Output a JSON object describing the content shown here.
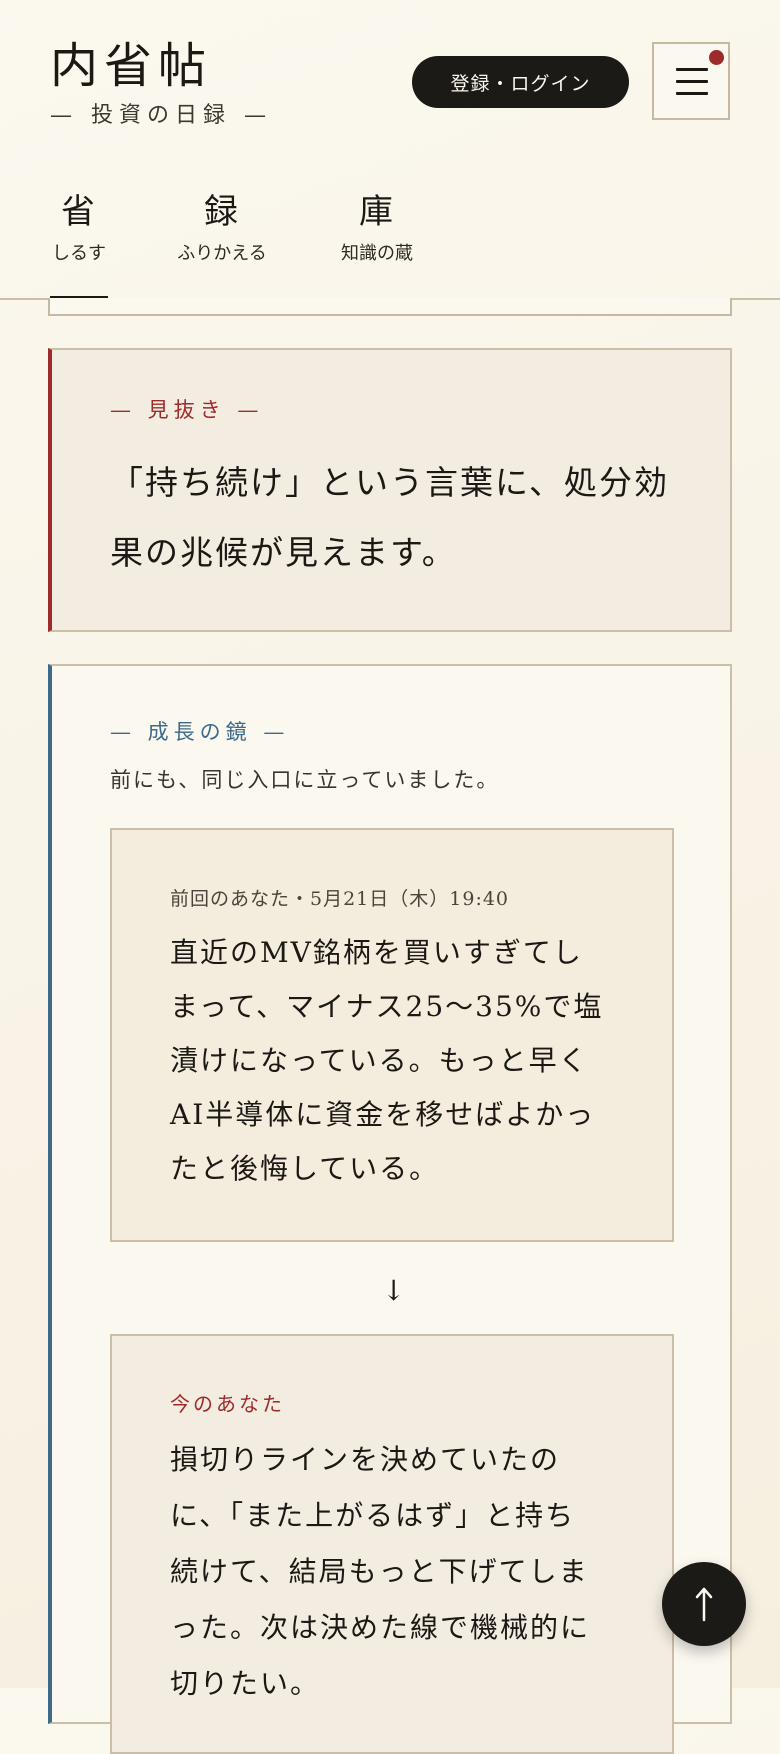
{
  "header": {
    "title": "内省帖",
    "subtitle": "— 投資の日録 —",
    "login_label": "登録・ログイン",
    "menu_icon": "hamburger-menu-icon",
    "notification_color": "#9e2b2b"
  },
  "tabs": [
    {
      "kanji": "省",
      "label": "しるす",
      "active": true
    },
    {
      "kanji": "録",
      "label": "ふりかえる",
      "active": false
    },
    {
      "kanji": "庫",
      "label": "知識の蔵",
      "active": false
    }
  ],
  "insight": {
    "label": "— 見抜き —",
    "text": "「持ち続け」という言葉に、処分効果の兆候が見えます。",
    "accent_color": "#9e2b2b"
  },
  "growth": {
    "label": "— 成長の鏡 —",
    "description": "前にも、同じ入口に立っていました。",
    "accent_color": "#3d6a8a",
    "past": {
      "label": "前回のあなた・5月21日（木）19:40",
      "text": "直近のMV銘柄を買いすぎてしまって、マイナス25〜35%で塩漬けになっている。もっと早くAI半導体に資金を移せばよかったと後悔している。"
    },
    "arrow": "↓",
    "now": {
      "label": "今のあなた",
      "text": "損切りラインを決めていたのに、「また上がるはず」と持ち続けて、結局もっと下げてしまった。次は決めた線で機械的に切りたい。"
    }
  },
  "floating": {
    "to_top_icon": "arrow-up-icon"
  }
}
